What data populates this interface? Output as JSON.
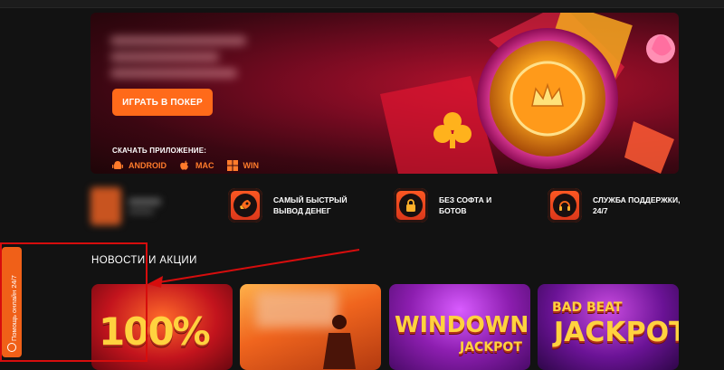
{
  "hero": {
    "play_button": "ИГРАТЬ В ПОКЕР",
    "download_label": "СКАЧАТЬ ПРИЛОЖЕНИЕ:",
    "platforms": [
      {
        "label": "ANDROID",
        "icon": "android-icon"
      },
      {
        "label": "MAC",
        "icon": "apple-icon"
      },
      {
        "label": "WIN",
        "icon": "windows-icon"
      }
    ]
  },
  "features": [
    {
      "text": "САМЫЙ БЫСТРЫЙ\nВЫВОД ДЕНЕГ",
      "icon": "rocket-icon"
    },
    {
      "text": "БЕЗ СОФТА И\nБОТОВ",
      "icon": "lock-icon"
    },
    {
      "text": "СЛУЖБА ПОДДЕРЖКИ,\n24/7",
      "icon": "headset-icon"
    }
  ],
  "news": {
    "title": "НОВОСТИ И АКЦИИ",
    "cards": [
      {
        "text": "100%"
      },
      {
        "text": ""
      },
      {
        "text_main": "WINDOWN",
        "text_sub": "JACKPOT"
      },
      {
        "text_top": "BAD BEAT",
        "text_main": "JACKPOT"
      }
    ]
  },
  "help_tab": {
    "label": "Помощь онлайн 24/7"
  },
  "colors": {
    "accent": "#ff6a1a",
    "background": "#121212",
    "annotation": "#d60d0d"
  }
}
